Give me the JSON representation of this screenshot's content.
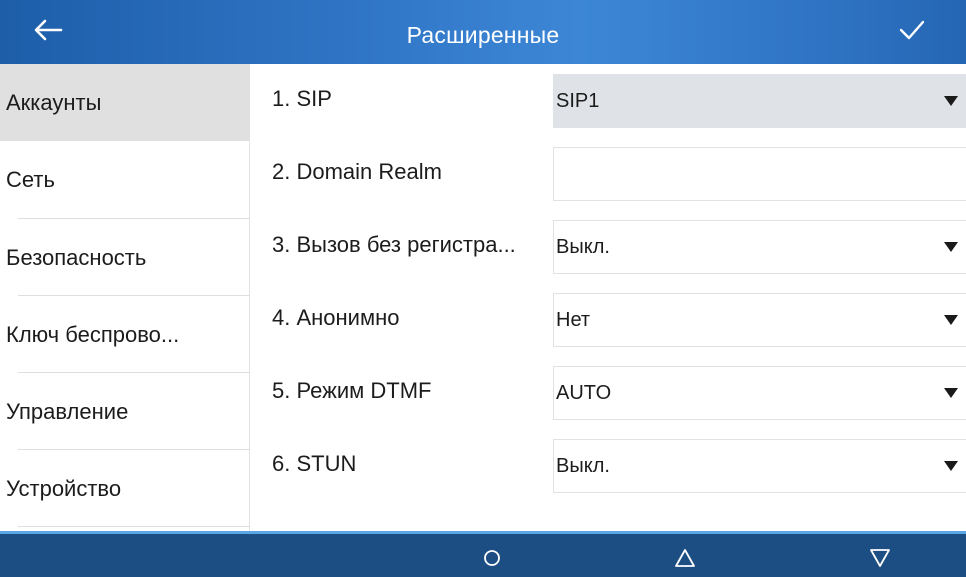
{
  "header": {
    "title": "Расширенные",
    "back_icon": "arrow-left-icon",
    "confirm_icon": "checkmark-icon"
  },
  "sidebar": {
    "items": [
      {
        "label": "Аккаунты",
        "active": true
      },
      {
        "label": "Сеть",
        "active": false
      },
      {
        "label": "Безопасность",
        "active": false
      },
      {
        "label": "Ключ беспрово...",
        "active": false
      },
      {
        "label": "Управление",
        "active": false
      },
      {
        "label": "Устройство",
        "active": false
      }
    ]
  },
  "settings": [
    {
      "label": "1. SIP",
      "value": "SIP1",
      "type": "dropdown"
    },
    {
      "label": "2. Domain Realm",
      "value": "",
      "type": "text"
    },
    {
      "label": "3. Вызов без регистра...",
      "value": "Выкл.",
      "type": "dropdown"
    },
    {
      "label": "4. Анонимно",
      "value": "Нет",
      "type": "dropdown"
    },
    {
      "label": "5. Режим DTMF",
      "value": "AUTO",
      "type": "dropdown"
    },
    {
      "label": "6. STUN",
      "value": "Выкл.",
      "type": "dropdown"
    }
  ],
  "navbar": {
    "home_icon": "circle-home-icon",
    "up_icon": "triangle-up-icon",
    "down_icon": "triangle-down-icon"
  },
  "colors": {
    "header_bg": "#2f74c4",
    "navbar_bg": "#1d4e83",
    "active_item_bg": "#e0e0e0",
    "dropdown_highlight": "#dfe2e6"
  }
}
